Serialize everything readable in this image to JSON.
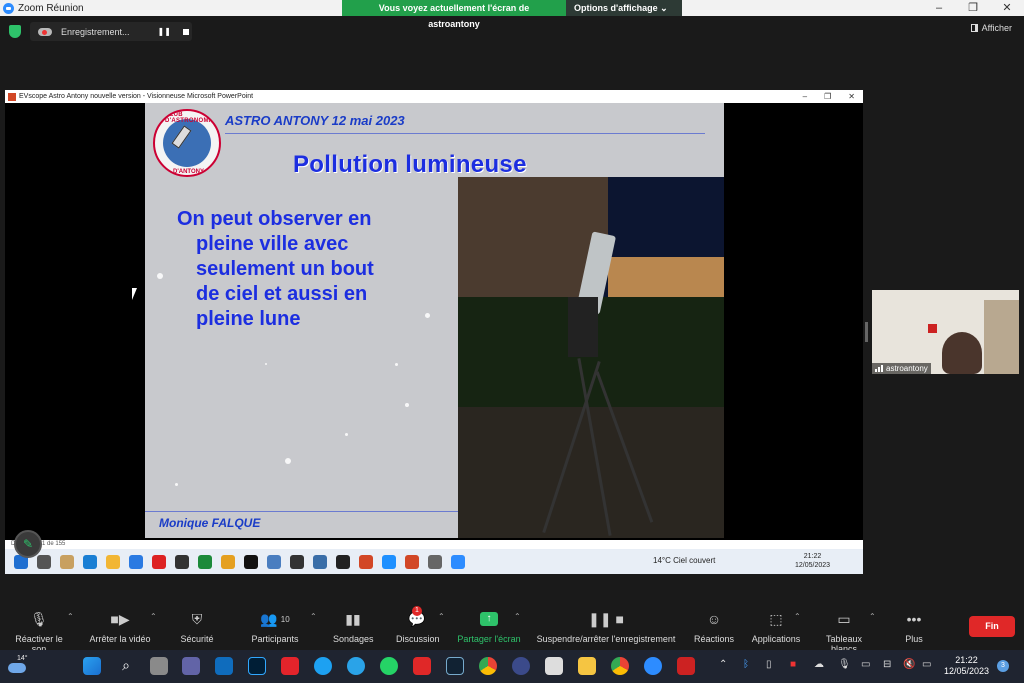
{
  "window": {
    "title": "Zoom Réunion",
    "controls": [
      "–",
      "❐",
      "✕"
    ]
  },
  "share_banner": {
    "message": "Vous voyez actuellement l'écran de astroantony",
    "options_label": "Options d'affichage ⌄"
  },
  "recording": {
    "label": "Enregistrement..."
  },
  "view": {
    "label": "Afficher"
  },
  "ppt_window": {
    "title": "EVscope Astro Antony nouvelle version - Visionneuse Microsoft PowerPoint",
    "status": "Diapositive 1 de 155"
  },
  "slide": {
    "header": "ASTRO ANTONY 12 mai 2023",
    "title": "Pollution lumineuse",
    "body": [
      "On peut observer en",
      "pleine ville avec",
      "seulement un bout",
      "de ciel et aussi en",
      "pleine lune"
    ],
    "footer": "Monique FALQUE",
    "logo_text_top": "CLUB D'ASTRONOMIE",
    "logo_text_bottom": "D'ANTONY"
  },
  "inner_taskbar": {
    "weather": "14°C  Ciel couvert",
    "time": "21:22",
    "date": "12/05/2023"
  },
  "participant": {
    "name": "astroantony"
  },
  "toolbar": {
    "unmute": "Réactiver le son",
    "video": "Arrêter la vidéo",
    "security": "Sécurité",
    "participants": "Participants",
    "participants_count": "10",
    "polls": "Sondages",
    "chat": "Discussion",
    "chat_badge": "1",
    "share": "Partager l'écran",
    "recording": "Suspendre/arrêter l'enregistrement",
    "reactions": "Réactions",
    "apps": "Applications",
    "whiteboards": "Tableaux blancs",
    "more": "Plus",
    "end": "Fin"
  },
  "taskbar": {
    "temp": "14°",
    "time": "21:22",
    "date": "12/05/2023",
    "notifications": "3"
  }
}
